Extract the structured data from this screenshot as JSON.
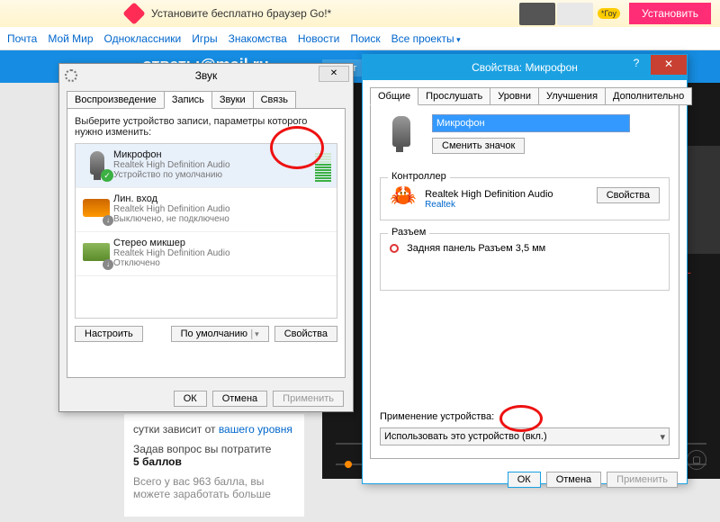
{
  "banner": {
    "text": "Установите бесплатно браузер Go!*",
    "tag": "*Гоу",
    "install": "Установить"
  },
  "nav": {
    "items": [
      "Почта",
      "Мой Мир",
      "Одноклассники",
      "Игры",
      "Знакомства",
      "Новости",
      "Поиск",
      "Все проекты"
    ]
  },
  "header": {
    "logo": "ответы@mail.ru",
    "tab": "☰ Кат"
  },
  "left": {
    "line1a": "сутки зависит от ",
    "line1b": "вашего уровня",
    "line2a": "Задав вопрос вы потратите",
    "line2b": "5 баллов",
    "line3": "Всего у вас 963 балла, вы можете заработать больше"
  },
  "sound": {
    "title": "Звук",
    "tabs": [
      "Воспроизведение",
      "Запись",
      "Звуки",
      "Связь"
    ],
    "instruction": "Выберите устройство записи, параметры которого нужно изменить:",
    "devices": [
      {
        "name": "Микрофон",
        "sub1": "Realtek High Definition Audio",
        "sub2": "Устройство по умолчанию"
      },
      {
        "name": "Лин. вход",
        "sub1": "Realtek High Definition Audio",
        "sub2": "Выключено, не подключено"
      },
      {
        "name": "Стерео микшер",
        "sub1": "Realtek High Definition Audio",
        "sub2": "Отключено"
      }
    ],
    "configure": "Настроить",
    "default": "По умолчанию",
    "properties": "Свойства",
    "ok": "ОК",
    "cancel": "Отмена",
    "apply": "Применить"
  },
  "prop": {
    "title": "Свойства: Микрофон",
    "tabs": [
      "Общие",
      "Прослушать",
      "Уровни",
      "Улучшения",
      "Дополнительно"
    ],
    "name_value": "Микрофон",
    "change_icon": "Сменить значок",
    "controller_label": "Контроллер",
    "controller_name": "Realtek High Definition Audio",
    "controller_vendor": "Realtek",
    "properties": "Свойства",
    "jack_label": "Разъем",
    "jack_value": "Задняя панель Разъем 3,5 мм",
    "usage_label": "Применение устройства:",
    "usage_value": "Использовать это устройство (вкл.)",
    "ok": "ОК",
    "cancel": "Отмена",
    "apply": "Применить"
  }
}
